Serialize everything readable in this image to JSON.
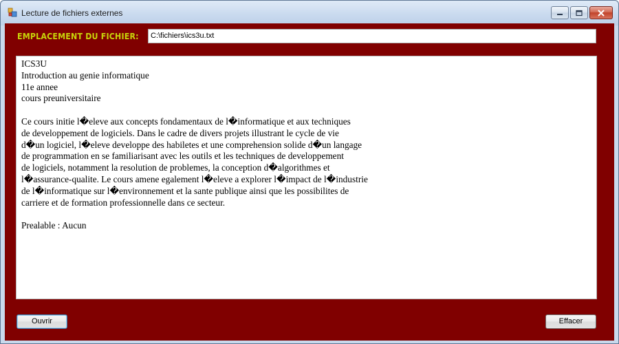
{
  "window": {
    "title": "Lecture de fichiers externes",
    "controls": [
      "minimize-icon",
      "maximize-icon",
      "close-icon"
    ]
  },
  "file_path": {
    "label": "EMPLACEMENT DU FICHIER:",
    "value": "C:\\fichiers\\ics3u.txt"
  },
  "content": {
    "text": "ICS3U\nIntroduction au genie informatique\n11e annee\ncours preuniversitaire\n\nCe cours initie l�eleve aux concepts fondamentaux de l�informatique et aux techniques\nde developpement de logiciels. Dans le cadre de divers projets illustrant le cycle de vie\nd�un logiciel, l�eleve developpe des habiletes et une comprehension solide d�un langage\nde programmation en se familiarisant avec les outils et les techniques de developpement\nde logiciels, notamment la resolution de problemes, la conception d�algorithmes et\nl�assurance-qualite. Le cours amene egalement l�eleve a explorer l�impact de l�industrie\nde l�informatique sur l�environnement et la sante publique ainsi que les possibilites de\ncarriere et de formation professionnelle dans ce secteur.\n\nPrealable : Aucun"
  },
  "buttons": {
    "open_label": "Ouvrir",
    "clear_label": "Effacer"
  },
  "colors": {
    "client_background": "#800000",
    "label_color": "#c8d40a"
  }
}
